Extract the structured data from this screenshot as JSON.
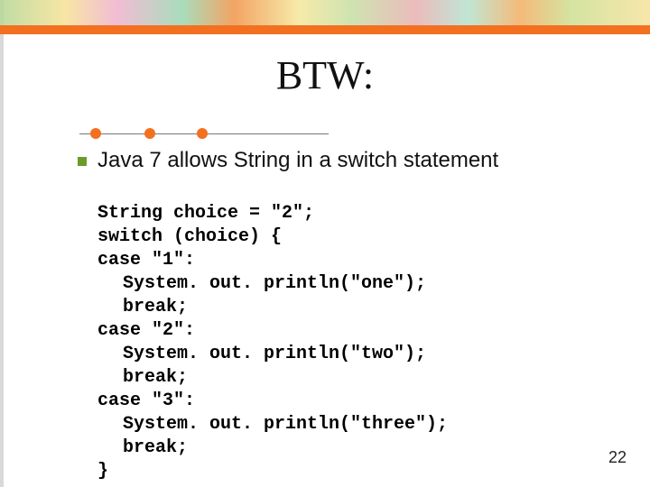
{
  "title": "BTW:",
  "bullet_text": "Java 7 allows String in a switch statement",
  "code": {
    "l1": "String choice = \"2\";",
    "l2": "switch (choice) {",
    "l3": "case \"1\":",
    "l4": "System. out. println(\"one\");",
    "l5": "break;",
    "l6": "case \"2\":",
    "l7": "System. out. println(\"two\");",
    "l8": "break;",
    "l9": "case \"3\":",
    "l10": "System. out. println(\"three\");",
    "l11": "break;",
    "l12": "}"
  },
  "page_number": "22"
}
